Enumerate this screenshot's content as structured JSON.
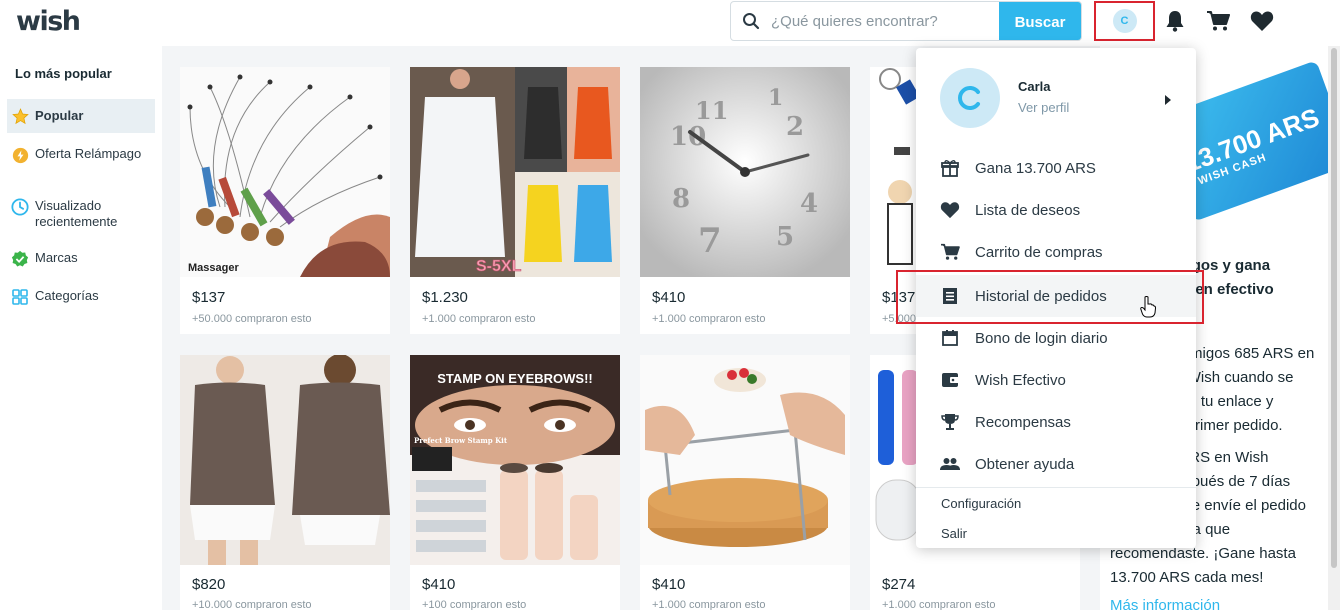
{
  "header": {
    "logo": "wish",
    "search_placeholder": "¿Qué quieres encontrar?",
    "search_button": "Buscar",
    "avatar_initial": "C"
  },
  "sidebar": {
    "title": "Lo más popular",
    "items": [
      {
        "label": "Popular",
        "icon": "star-icon"
      },
      {
        "label": "Oferta Relámpago",
        "icon": "lightning-icon"
      },
      {
        "label": "Visualizado recientemente",
        "icon": "clock-icon"
      },
      {
        "label": "Marcas",
        "icon": "verified-badge-icon"
      },
      {
        "label": "Categorías",
        "icon": "grid-icon"
      }
    ]
  },
  "products": [
    {
      "price": "$137",
      "sold": "+50.000 compraron esto",
      "image_caption": "Massager"
    },
    {
      "price": "$1.230",
      "sold": "+1.000 compraron esto",
      "image_caption": "S-5XL"
    },
    {
      "price": "$410",
      "sold": "+1.000 compraron esto"
    },
    {
      "price": "$137",
      "sold": "+5.000 compraron esto"
    },
    {
      "price": "$820",
      "sold": "+10.000 compraron esto"
    },
    {
      "price": "$410",
      "sold": "+100 compraron esto",
      "image_caption": "STAMP ON EYEBROWS!!",
      "image_subcaption": "Prefect Brow Stamp Kit"
    },
    {
      "price": "$410",
      "sold": "+1.000 compraron esto"
    },
    {
      "price": "$274",
      "sold": "+1.000 compraron esto"
    }
  ],
  "promo": {
    "card_amount": "13.700 ARS",
    "card_label": "WISH CASH",
    "headline": "Invita a amigos y gana 13.700 ARS en efectivo",
    "body_1": "Dale a tus amigos 685 ARS en efectivo en Wish cuando se registren con tu enlace y realicen su primer pedido.",
    "body_2": "Gana 685 ARS en Wish Efectivo después de 7 días desde que se envíe el pedido de la persona que recomendaste. ¡Gane hasta 13.700 ARS cada mes!",
    "more": "Más información"
  },
  "dropdown": {
    "user_name": "Carla",
    "view_profile": "Ver perfil",
    "items": [
      {
        "label": "Gana 13.700 ARS",
        "icon": "gift-icon"
      },
      {
        "label": "Lista de deseos",
        "icon": "heart-icon"
      },
      {
        "label": "Carrito de compras",
        "icon": "cart-icon"
      },
      {
        "label": "Historial de pedidos",
        "icon": "receipt-icon"
      },
      {
        "label": "Bono de login diario",
        "icon": "calendar-icon"
      },
      {
        "label": "Wish Efectivo",
        "icon": "wallet-icon"
      },
      {
        "label": "Recompensas",
        "icon": "trophy-icon"
      },
      {
        "label": "Obtener ayuda",
        "icon": "people-icon"
      }
    ],
    "settings": "Configuración",
    "logout": "Salir"
  },
  "colors": {
    "accent": "#2fb7ec",
    "highlight_border": "#d9242f",
    "text": "#192a32",
    "muted": "#8a979f"
  }
}
